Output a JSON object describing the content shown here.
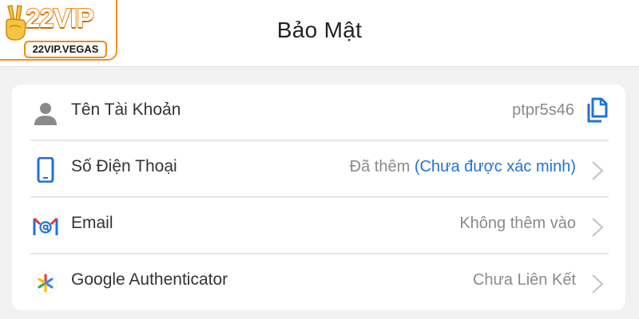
{
  "header": {
    "title": "Bảo Mật",
    "logo": {
      "main": "22VIP",
      "sub": "22VIP.VEGAS"
    }
  },
  "security": {
    "rows": [
      {
        "label": "Tên Tài Khoản",
        "value": "ptpr5s46",
        "icon": "user-icon",
        "action": "copy-icon"
      },
      {
        "label": "Số Điện Thoại",
        "value": "Đã thêm",
        "status": "(Chưa được xác minh)",
        "icon": "phone-icon",
        "action": "chevron-right-icon"
      },
      {
        "label": "Email",
        "value": "Không thêm vào",
        "icon": "email-icon",
        "action": "chevron-right-icon"
      },
      {
        "label": "Google Authenticator",
        "value": "Chưa Liên Kết",
        "icon": "google-authenticator-icon",
        "action": "chevron-right-icon"
      }
    ]
  },
  "colors": {
    "accent": "#1f73d6",
    "logo_orange": "#f08a10",
    "background": "#f2f2f2"
  }
}
